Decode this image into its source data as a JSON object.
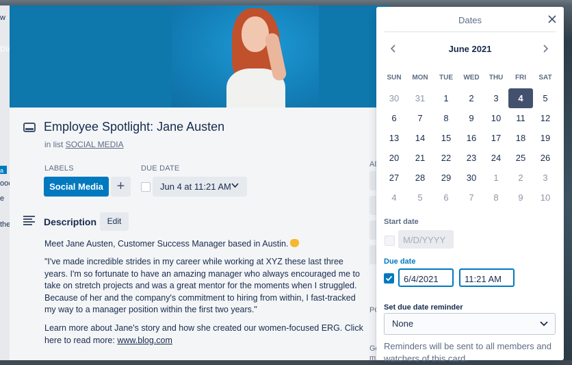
{
  "background": {
    "left_text": [
      "w",
      "DIA",
      "ooc",
      "e",
      "the",
      "a"
    ]
  },
  "card": {
    "title": "Employee Spotlight: Jane Austen",
    "in_list_prefix": "in list",
    "list_name": "SOCIAL MEDIA",
    "labels_heading": "LABELS",
    "label": "Social Media",
    "add_label": "+",
    "due_heading": "DUE DATE",
    "due_value": "Jun 4 at 11:21 AM",
    "description_heading": "Description",
    "edit_label": "Edit",
    "description": {
      "p1": "Meet Jane Austen, Customer Success Manager based in Austin.",
      "p2": "\"I've made incredible strides in my career while working at XYZ these last three years. I'm so fortunate to have an amazing manager who always encouraged me to take on stretch projects and was a great mentor for the moments when I struggled. Because of her and the company's commitment to hiring from within, I fast-tracked my way to a manager position within the first two years.\"",
      "p3_text": "Learn more about Jane's story and how she created our women-focused ERG. Click here to read more:",
      "p3_link": "www.blog.com"
    },
    "side_partial": [
      "AD",
      "PO",
      "Ge",
      "m"
    ]
  },
  "dates_popover": {
    "title": "Dates",
    "month": "June 2021",
    "weekdays": [
      "SUN",
      "MON",
      "TUE",
      "WED",
      "THU",
      "FRI",
      "SAT"
    ],
    "weeks": [
      [
        {
          "d": "30",
          "out": true
        },
        {
          "d": "31",
          "out": true
        },
        {
          "d": "1"
        },
        {
          "d": "2"
        },
        {
          "d": "3"
        },
        {
          "d": "4",
          "sel": true
        },
        {
          "d": "5"
        }
      ],
      [
        {
          "d": "6"
        },
        {
          "d": "7"
        },
        {
          "d": "8"
        },
        {
          "d": "9"
        },
        {
          "d": "10"
        },
        {
          "d": "11"
        },
        {
          "d": "12"
        }
      ],
      [
        {
          "d": "13"
        },
        {
          "d": "14"
        },
        {
          "d": "15"
        },
        {
          "d": "16"
        },
        {
          "d": "17"
        },
        {
          "d": "18"
        },
        {
          "d": "19"
        }
      ],
      [
        {
          "d": "20"
        },
        {
          "d": "21"
        },
        {
          "d": "22"
        },
        {
          "d": "23"
        },
        {
          "d": "24"
        },
        {
          "d": "25"
        },
        {
          "d": "26"
        }
      ],
      [
        {
          "d": "27"
        },
        {
          "d": "28"
        },
        {
          "d": "29"
        },
        {
          "d": "30"
        },
        {
          "d": "1",
          "out": true
        },
        {
          "d": "2",
          "out": true
        },
        {
          "d": "3",
          "out": true
        }
      ],
      [
        {
          "d": "4",
          "out": true
        },
        {
          "d": "5",
          "out": true
        },
        {
          "d": "6",
          "out": true
        },
        {
          "d": "7",
          "out": true
        },
        {
          "d": "8",
          "out": true
        },
        {
          "d": "9",
          "out": true
        },
        {
          "d": "10",
          "out": true
        }
      ]
    ],
    "start_date_label": "Start date",
    "start_date_placeholder": "M/D/YYYY",
    "start_date_checked": false,
    "due_date_label": "Due date",
    "due_date_checked": true,
    "due_date_value": "6/4/2021",
    "due_time_value": "11:21 AM",
    "reminder_label": "Set due date reminder",
    "reminder_value": "None",
    "reminder_note": "Reminders will be sent to all members and watchers of this card."
  },
  "colors": {
    "accent": "#0079bf",
    "label_blue": "#0079bf",
    "selected_day": "#42526e"
  },
  "icons": [
    "card-icon",
    "description-icon",
    "close-icon",
    "chevron-left-icon",
    "chevron-right-icon",
    "chevron-down-icon",
    "checkbox-icon"
  ]
}
